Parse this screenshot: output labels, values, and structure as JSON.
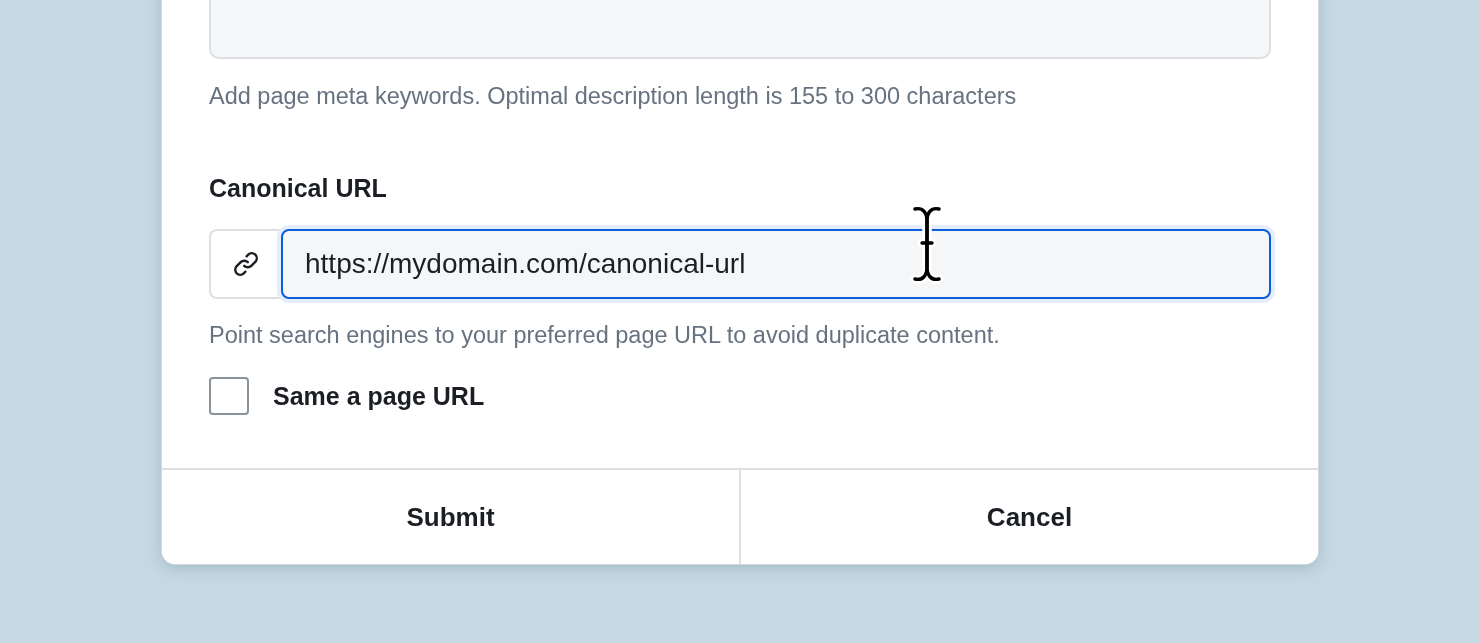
{
  "meta_keywords": {
    "help": "Add page meta keywords. Optimal description length is 155 to 300 characters"
  },
  "canonical_url": {
    "label": "Canonical URL",
    "value": "https://mydomain.com/canonical-url",
    "focused": true,
    "help": "Point search engines to your preferred page URL to avoid duplicate content."
  },
  "same_as_page": {
    "label": "Same a page URL",
    "checked": false
  },
  "buttons": [
    {
      "label": "Submit"
    },
    {
      "label": "Cancel"
    }
  ]
}
